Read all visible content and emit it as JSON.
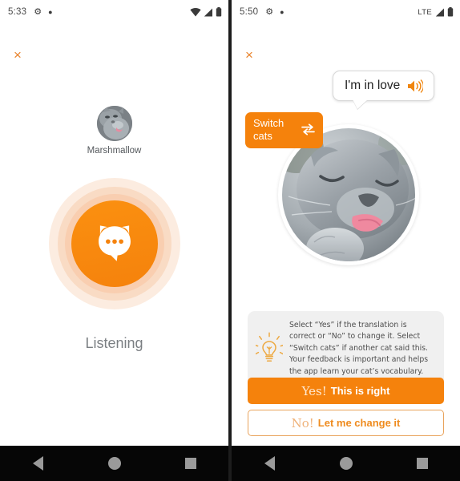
{
  "colors": {
    "orange": "#f5820c",
    "orange_light": "#e8822a",
    "tip_bg": "#f0f0f0",
    "nav_bg": "#060606"
  },
  "left_screen": {
    "statusbar": {
      "time": "5:33",
      "gear_icon": "gear-icon",
      "dot_icon": "dot-icon",
      "wifi_icon": "wifi-icon",
      "signal_icon": "signal-icon",
      "battery_icon": "battery-icon"
    },
    "close_label": "×",
    "cat": {
      "avatar_icon": "cat-avatar",
      "name": "Marshmallow"
    },
    "listen": {
      "button_icon": "cat-speech-bubble-icon",
      "status_label": "Listening"
    }
  },
  "right_screen": {
    "statusbar": {
      "time": "5:50",
      "gear_icon": "gear-icon",
      "dot_icon": "dot-icon",
      "network_label": "LTE",
      "signal_icon": "signal-icon",
      "battery_icon": "battery-icon"
    },
    "close_label": "×",
    "translation": {
      "text": "I'm in love",
      "speaker_icon": "speaker-icon"
    },
    "switch_cats": {
      "label": "Switch cats",
      "icon": "swap-arrows-icon"
    },
    "cat_photo_icon": "cat-photo",
    "tip": {
      "bulb_icon": "lightbulb-icon",
      "text": "Select “Yes” if the translation is correct or “No” to change it. Select “Switch cats” if another cat said this. Your feedback is important and helps the app learn your cat’s vocabulary."
    },
    "buttons": {
      "yes_lead": "Yes!",
      "yes_rest": "This is right",
      "no_lead": "No!",
      "no_rest": "Let me change it"
    }
  },
  "navbar": {
    "back_icon": "back-triangle-icon",
    "home_icon": "home-circle-icon",
    "recents_icon": "recents-square-icon"
  }
}
